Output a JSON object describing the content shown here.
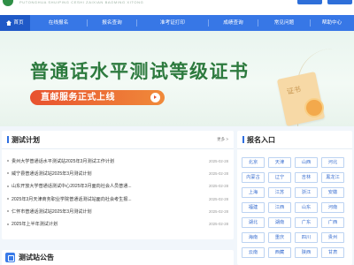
{
  "topbar": {
    "logo_subtitle": "PUTONGHUA SHUIPING CESHI ZAIXIAN BAOMING XITONG"
  },
  "nav": {
    "items": [
      "首页",
      "在线报名",
      "报名查询",
      "准考证打印",
      "成绩查询",
      "常见问题",
      "帮助中心"
    ]
  },
  "banner": {
    "title": "普通话水平测试等级证书",
    "subtitle": "直邮服务正式上线",
    "cert_label": "证书"
  },
  "test_plan": {
    "title": "测试计划",
    "more_label": "更多 >",
    "items": [
      {
        "title": "贵州大学普通话水平测试站2025年3月测试工作计划",
        "date": "2025-02-28"
      },
      {
        "title": "威宁县普通话测试站2025年3月测试计划",
        "date": "2025-02-28"
      },
      {
        "title": "山东开放大学普通话测试中心2025年3月面向社会人员普通...",
        "date": "2025-02-28"
      },
      {
        "title": "2025年3月天津商务职业学院普通话测试站面向社会考生报...",
        "date": "2025-02-28"
      },
      {
        "title": "仁怀市普通话测试站2025年3月测试计划",
        "date": "2025-02-28"
      },
      {
        "title": "2025年上半年测试计划",
        "date": "2025-02-28"
      }
    ]
  },
  "registration": {
    "title": "报名入口",
    "regions": [
      "北京",
      "天津",
      "山西",
      "河北",
      "内蒙古",
      "辽宁",
      "吉林",
      "黑龙江",
      "上海",
      "江苏",
      "浙江",
      "安徽",
      "福建",
      "江西",
      "山东",
      "河南",
      "湖北",
      "湖南",
      "广东",
      "广西",
      "海南",
      "重庆",
      "四川",
      "贵州",
      "云南",
      "西藏",
      "陕西",
      "甘肃"
    ]
  },
  "announcements": {
    "title": "测试站公告"
  }
}
